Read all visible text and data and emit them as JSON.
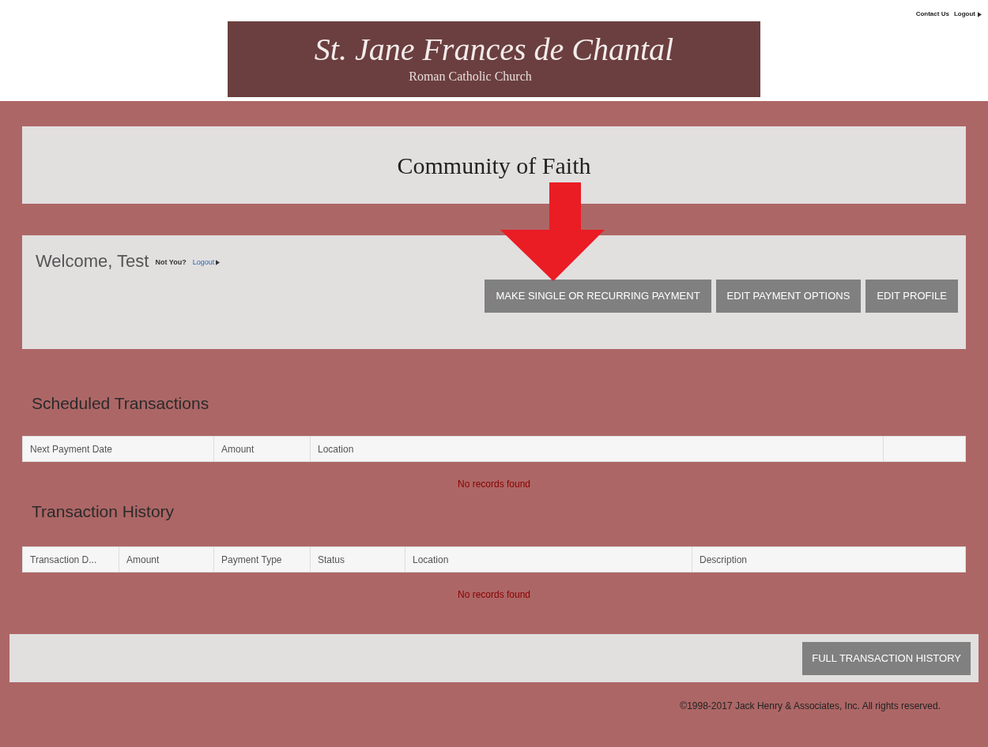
{
  "header": {
    "links": [
      {
        "label": "Contact Us"
      },
      {
        "label": "Logout"
      }
    ],
    "logo": {
      "title": "St. Jane Frances de Chantal",
      "subtitle": "Roman Catholic Church"
    }
  },
  "page_title": "Community of Faith",
  "welcome": {
    "greeting": "Welcome, Test",
    "not_you": "Not You?",
    "logout": "Logout",
    "buttons": [
      "MAKE SINGLE OR RECURRING PAYMENT",
      "EDIT PAYMENT OPTIONS",
      "EDIT PROFILE"
    ]
  },
  "scheduled": {
    "title": "Scheduled Transactions",
    "columns": [
      "Next Payment Date",
      "Amount",
      "Location",
      ""
    ],
    "empty": "No records found"
  },
  "history": {
    "title": "Transaction History",
    "columns": [
      "Transaction D...",
      "Amount",
      "Payment Type",
      "Status",
      "Location",
      "Description"
    ],
    "empty": "No records found"
  },
  "footer_button": "FULL TRANSACTION HISTORY",
  "copyright": "©1998-2017 Jack Henry & Associates, Inc. All rights reserved."
}
